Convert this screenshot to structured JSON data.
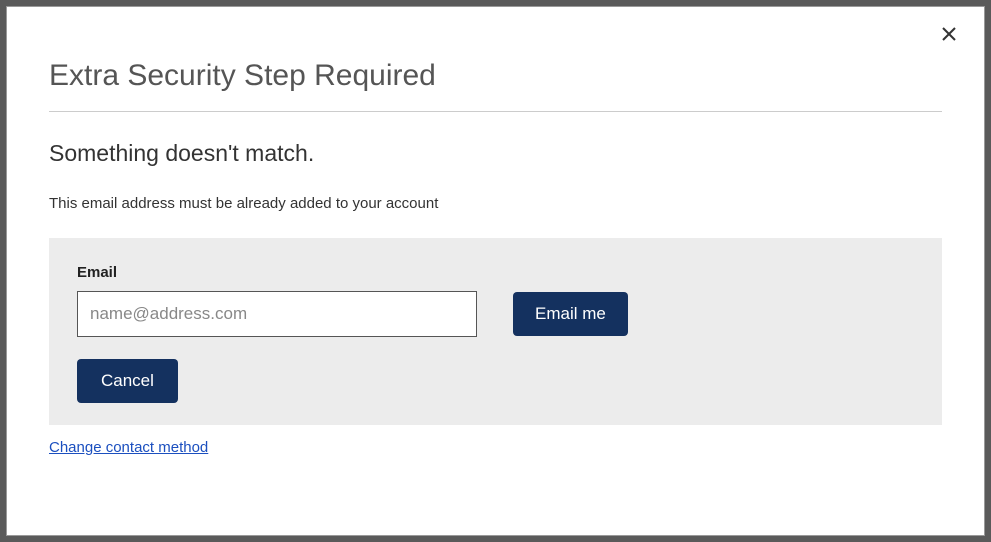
{
  "modal": {
    "title": "Extra Security Step Required",
    "subtitle": "Something doesn't match.",
    "instruction": "This email address must be already added to your account",
    "close_icon": "close"
  },
  "form": {
    "email_label": "Email",
    "email_placeholder": "name@address.com",
    "email_value": "",
    "submit_label": "Email me",
    "cancel_label": "Cancel"
  },
  "footer": {
    "change_link": "Change contact method"
  },
  "colors": {
    "primary_button": "#14315f",
    "link": "#1b4fbf",
    "panel_bg": "#ececec"
  }
}
